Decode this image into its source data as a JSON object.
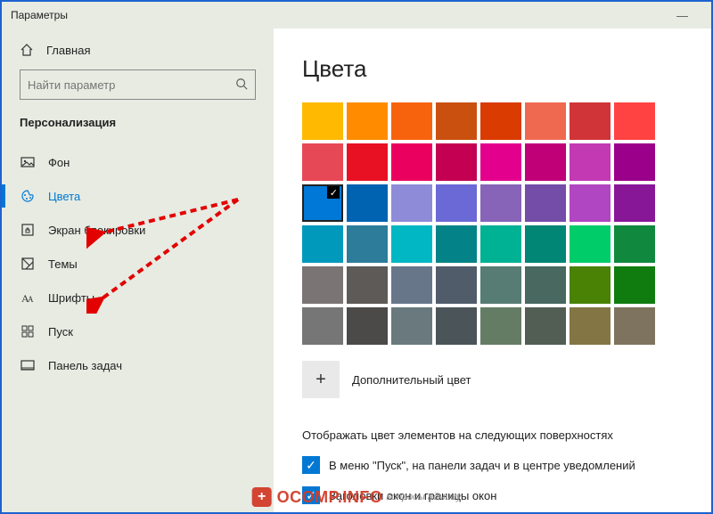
{
  "window": {
    "title": "Параметры",
    "minimize_glyph": "—"
  },
  "sidebar": {
    "home": "Главная",
    "search_placeholder": "Найти параметр",
    "section": "Персонализация",
    "items": [
      {
        "label": "Фон",
        "icon": "image-icon"
      },
      {
        "label": "Цвета",
        "icon": "palette-icon",
        "active": true
      },
      {
        "label": "Экран блокировки",
        "icon": "lock-screen-icon"
      },
      {
        "label": "Темы",
        "icon": "themes-icon"
      },
      {
        "label": "Шрифты",
        "icon": "fonts-icon"
      },
      {
        "label": "Пуск",
        "icon": "start-icon"
      },
      {
        "label": "Панель задач",
        "icon": "taskbar-icon"
      }
    ]
  },
  "main": {
    "heading": "Цвета",
    "custom_color_label": "Дополнительный цвет",
    "surfaces_title": "Отображать цвет элементов на следующих поверхностях",
    "checkbox1": "В меню \"Пуск\", на панели задач и в центре уведомлений",
    "checkbox2": "Заголовки окон и границы окон",
    "selected_index": 16,
    "swatches": [
      "#ffb900",
      "#ff8c00",
      "#f7630c",
      "#ca5010",
      "#da3b01",
      "#ef6950",
      "#d13438",
      "#ff4343",
      "#e74856",
      "#e81123",
      "#ea005e",
      "#c30052",
      "#e3008c",
      "#bf0077",
      "#c239b3",
      "#9a0089",
      "#0078d7",
      "#0063b1",
      "#8e8cd8",
      "#6b69d6",
      "#8764b8",
      "#744da9",
      "#b146c2",
      "#881798",
      "#0099bc",
      "#2d7d9a",
      "#00b7c3",
      "#038387",
      "#00b294",
      "#018574",
      "#00cc6a",
      "#10893e",
      "#7a7574",
      "#5d5a58",
      "#68768a",
      "#515c6b",
      "#567c73",
      "#486860",
      "#498205",
      "#107c10",
      "#767676",
      "#4c4a48",
      "#69797e",
      "#4a5459",
      "#647c64",
      "#525e54",
      "#847545",
      "#7e735f"
    ]
  },
  "watermark": {
    "brand": "OCOMP.INFO",
    "tagline": "вопросы админу"
  }
}
